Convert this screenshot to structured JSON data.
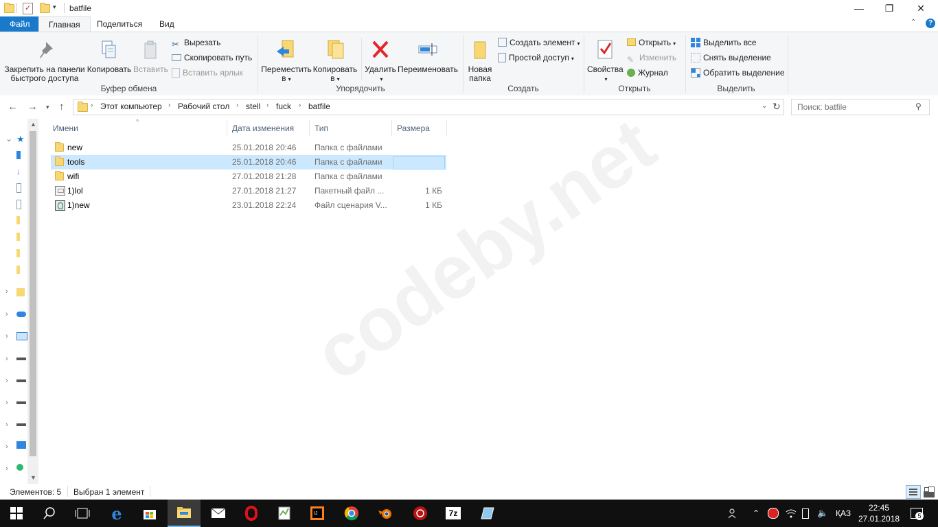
{
  "window": {
    "title": "batfile",
    "minimize_glyph": "—",
    "maximize_glyph": "❐",
    "close_glyph": "✕"
  },
  "ribbon_tabs": [
    "Файл",
    "Главная",
    "Поделиться",
    "Вид"
  ],
  "ribbon": {
    "clipboard": {
      "group_label": "Буфер обмена",
      "pin_line1": "Закрепить на панели",
      "pin_line2": "быстрого доступа",
      "copy": "Копировать",
      "paste": "Вставить",
      "cut": "Вырезать",
      "copy_path": "Скопировать путь",
      "paste_shortcut": "Вставить ярлык"
    },
    "organize": {
      "group_label": "Упорядочить",
      "move_line1": "Переместить",
      "move_line2": "в",
      "copyto_line1": "Копировать",
      "copyto_line2": "в",
      "delete": "Удалить",
      "rename": "Переименовать"
    },
    "new": {
      "group_label": "Создать",
      "new_folder_line1": "Новая",
      "new_folder_line2": "папка",
      "new_item": "Создать элемент",
      "easy_access": "Простой доступ"
    },
    "open": {
      "group_label": "Открыть",
      "properties": "Свойства",
      "open": "Открыть",
      "edit": "Изменить",
      "history": "Журнал"
    },
    "select": {
      "group_label": "Выделить",
      "select_all": "Выделить все",
      "select_none": "Снять выделение",
      "invert": "Обратить выделение"
    }
  },
  "address": {
    "breadcrumbs": [
      "Этот компьютер",
      "Рабочий стол",
      "stell",
      "fuck",
      "batfile"
    ]
  },
  "search": {
    "placeholder": "Поиск: batfile"
  },
  "columns": {
    "name": "Имени",
    "date": "Дата изменения",
    "type": "Тип",
    "size": "Размера"
  },
  "files": [
    {
      "name": "new",
      "date": "25.01.2018 20:46",
      "type": "Папка с файлами",
      "size": "",
      "icon": "folder-icon"
    },
    {
      "name": "tools",
      "date": "25.01.2018 20:46",
      "type": "Папка с файлами",
      "size": "",
      "icon": "folder-icon",
      "selected": true
    },
    {
      "name": "wifi",
      "date": "27.01.2018 21:28",
      "type": "Папка с файлами",
      "size": "",
      "icon": "folder-icon"
    },
    {
      "name": "1)lol",
      "date": "27.01.2018 21:27",
      "type": "Пакетный файл ...",
      "size": "1 КБ",
      "icon": "batch-file-icon"
    },
    {
      "name": "1)new",
      "date": "23.01.2018 22:24",
      "type": "Файл сценария V...",
      "size": "1 КБ",
      "icon": "vbscript-file-icon"
    }
  ],
  "watermark": "codeby.net",
  "status": {
    "count": "Элементов: 5",
    "selected": "Выбран 1 элемент"
  },
  "taskbar": {
    "language": "ҚАЗ",
    "time": "22:45",
    "date": "27.01.2018",
    "notifications": "5",
    "apps": [
      "windows-start",
      "search",
      "task-view",
      "edge",
      "store",
      "file-explorer",
      "mail",
      "opera",
      "notepad-plus",
      "intellij",
      "chrome",
      "blender",
      "app-red",
      "7zip",
      "app-blue"
    ]
  },
  "colors": {
    "accent": "#1979ca",
    "selection": "#cce8ff",
    "taskbar": "#101010"
  }
}
